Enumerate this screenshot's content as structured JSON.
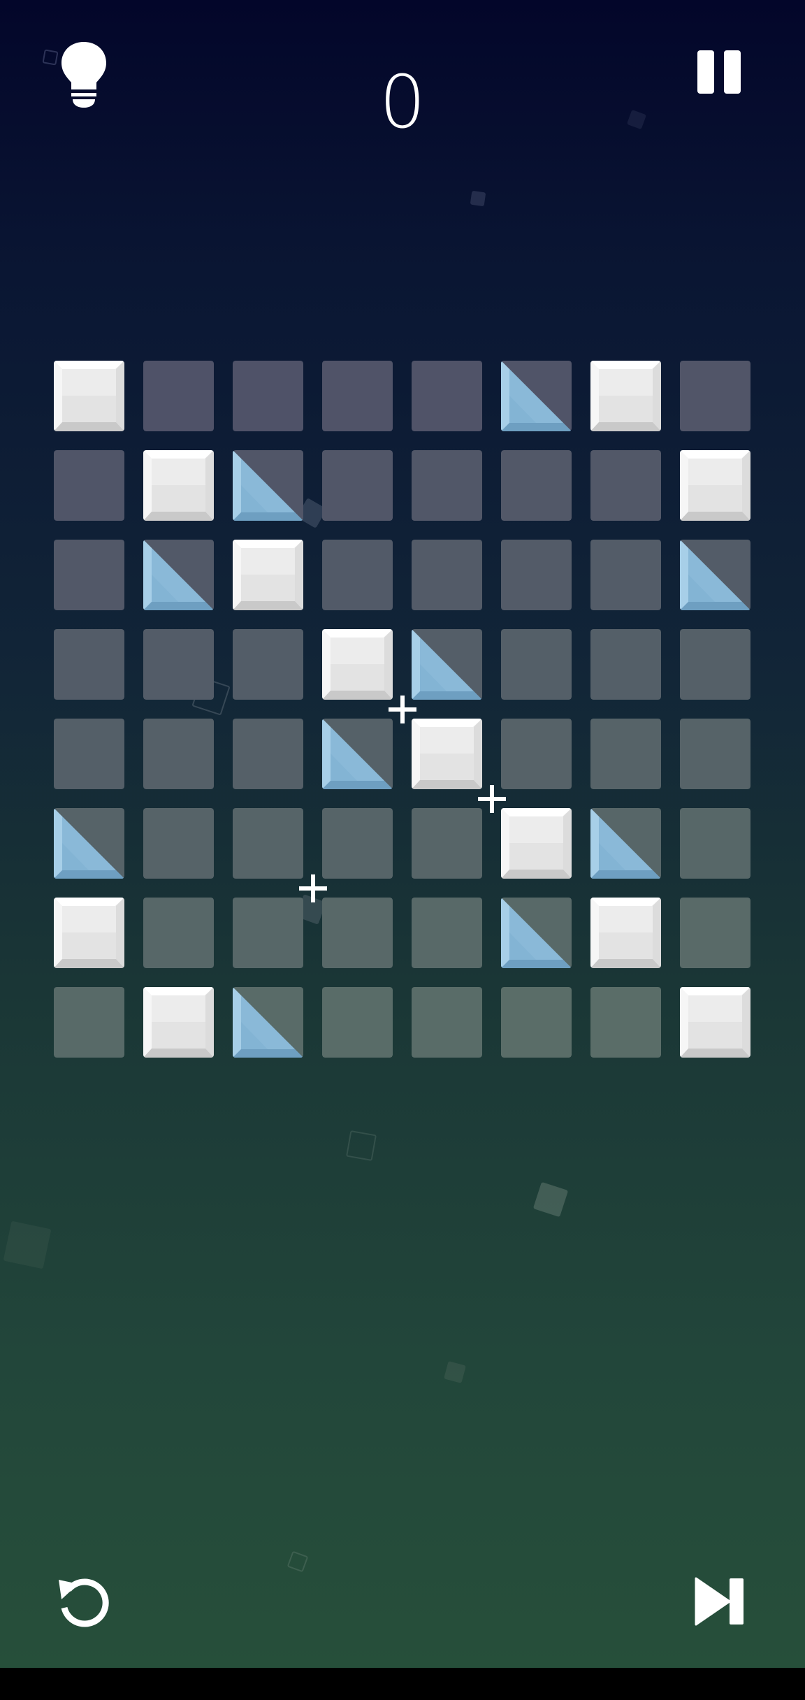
{
  "score": "0",
  "colors": {
    "empty_tile_top": "#4f5168",
    "empty_tile_bottom": "#5a6e68",
    "white_tile": "#eaeaea",
    "mirror_blue": "#8ab9d8",
    "icon": "#ffffff"
  },
  "icons": {
    "hint": "lightbulb-icon",
    "pause": "pause-icon",
    "restart": "restart-icon",
    "skip": "skip-next-icon",
    "target": "plus-icon"
  },
  "board": {
    "size": 8,
    "legend": {
      "W": "white-block",
      "M": "blue-mirror",
      ".": "empty-cell"
    },
    "rows": [
      [
        "W",
        ".",
        ".",
        ".",
        ".",
        "M",
        "W",
        "."
      ],
      [
        ".",
        "W",
        "M",
        ".",
        ".",
        ".",
        ".",
        "W"
      ],
      [
        ".",
        "M",
        "W",
        ".",
        ".",
        ".",
        ".",
        "M"
      ],
      [
        ".",
        ".",
        ".",
        "W",
        "M",
        ".",
        ".",
        "."
      ],
      [
        ".",
        ".",
        ".",
        "M",
        "W",
        ".",
        ".",
        "."
      ],
      [
        "M",
        ".",
        ".",
        ".",
        ".",
        "W",
        "M",
        "."
      ],
      [
        "W",
        ".",
        ".",
        ".",
        ".",
        "M",
        "W",
        "."
      ],
      [
        ".",
        "W",
        "M",
        ".",
        ".",
        ".",
        ".",
        "W"
      ]
    ],
    "targets": [
      {
        "row": 3,
        "col": 4,
        "corner": "bottom-left"
      },
      {
        "row": 4,
        "col": 5,
        "corner": "bottom-left"
      },
      {
        "row": 5,
        "col": 3,
        "corner": "bottom-left"
      }
    ]
  }
}
